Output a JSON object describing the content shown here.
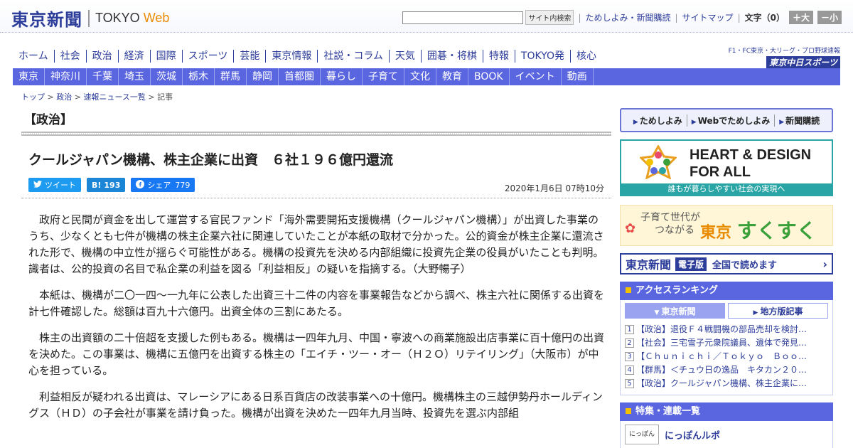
{
  "header": {
    "logo_jp": "東京新聞",
    "logo_en": "TOKYO",
    "logo_web": "Web",
    "search_btn": "サイト内検索",
    "link1": "ためしよみ・新聞購読",
    "link2": "サイトマップ",
    "font_label": "文字（0）",
    "font_big": "＋大",
    "font_small": "－小"
  },
  "mainnav": [
    "ホーム",
    "社会",
    "政治",
    "経済",
    "国際",
    "スポーツ",
    "芸能",
    "東京情報",
    "社説・コラム",
    "天気",
    "囲碁・将棋",
    "特報",
    "TOKYO発",
    "核心"
  ],
  "sports": {
    "line": "F1・FC東京・大リーグ・プロ野球速報",
    "logo": "東京中日スポーツ"
  },
  "subnav": [
    "東京",
    "神奈川",
    "千葉",
    "埼玉",
    "茨城",
    "栃木",
    "群馬",
    "静岡",
    "首都圏",
    "暮らし",
    "子育て",
    "文化",
    "教育",
    "BOOK",
    "イベント",
    "動画"
  ],
  "breadcrumb": {
    "top": "トップ",
    "sep": ">",
    "politics": "政治",
    "news": "速報ニュース一覧",
    "article": "記事"
  },
  "article": {
    "section": "【政治】",
    "headline": "クールジャパン機構、株主企業に出資　６社１９６億円還流",
    "tweet": "ツイート",
    "hatena_icon": "B!",
    "hatena_count": "193",
    "share": "シェア",
    "share_count": "779",
    "date": "2020年1月6日 07時10分",
    "paragraphs": [
      "政府と民間が資金を出して運営する官民ファンド「海外需要開拓支援機構（クールジャパン機構）」が出資した事業のうち、少なくとも七件が機構の株主企業六社に関連していたことが本紙の取材で分かった。公的資金が株主企業に還流された形で、機構の中立性が揺らぐ可能性がある。機構の投資先を決める内部組織に投資先企業の役員がいたことも判明。識者は、公的投資の名目で私企業の利益を図る「利益相反」の疑いを指摘する。（大野暢子）",
      "本紙は、機構が二〇一四～一九年に公表した出資三十二件の内容を事業報告などから調べ、株主六社に関係する出資を計七件確認した。総額は百九十六億円。出資全体の三割にあたる。",
      "株主の出資額の二十倍超を支援した例もある。機構は一四年九月、中国・寧波への商業施設出店事業に百十億円の出資を決めた。この事業は、機構に五億円を出資する株主の「エイチ・ツー・オー（Ｈ２Ｏ）リテイリング」（大阪市）が中心を担っている。",
      "利益相反が疑われる出資は、マレーシアにある日系百貨店の改装事業への十億円。機構株主の三越伊勢丹ホールディングス（ＨＤ）の子会社が事業を請け負った。機構が出資を決めた一四年九月当時、投資先を選ぶ内部組"
    ]
  },
  "sidebar": {
    "tameshi": [
      "ためしよみ",
      "Webでためしよみ",
      "新聞購読"
    ],
    "heart_title1": "HEART & DESIGN",
    "heart_title2": "FOR ALL",
    "heart_bar": "誰もが暮らしやすい社会の実現へ",
    "suku_tag1": "子育て世代が",
    "suku_tag2": "つながる",
    "suku_logo1": "東京",
    "suku_logo2": "すくすく",
    "eshimbun_logo": "東京新聞",
    "eshimbun_badge": "電子版",
    "eshimbun_text": "全国で読めます",
    "ranking_head": "アクセスランキング",
    "rank_tab1": "東京新聞",
    "rank_tab2": "地方版記事",
    "ranking": [
      {
        "n": "1",
        "t": "【政治】退役Ｆ４戦闘機の部品売却を検討…"
      },
      {
        "n": "2",
        "t": "【社会】三宅雪子元衆院議員、遺体で発見…"
      },
      {
        "n": "3",
        "t": "【Ｃｈｕｎｉｃｈｉ／Ｔｏｋｙｏ　Ｂｏｏ…"
      },
      {
        "n": "4",
        "t": "【群馬】＜チュウ日の逸品　キタカン２０…"
      },
      {
        "n": "5",
        "t": "【政治】クールジャパン機構、株主企業に…"
      }
    ],
    "feature_head": "特集・連載一覧",
    "feature_thumb": "にっぽん",
    "feature_title": "にっぽんルポ"
  },
  "colors": {
    "brand": "#2d3d9a",
    "nav": "#5a66e0",
    "accent": "#e98b00",
    "teal": "#2aa5a5"
  }
}
